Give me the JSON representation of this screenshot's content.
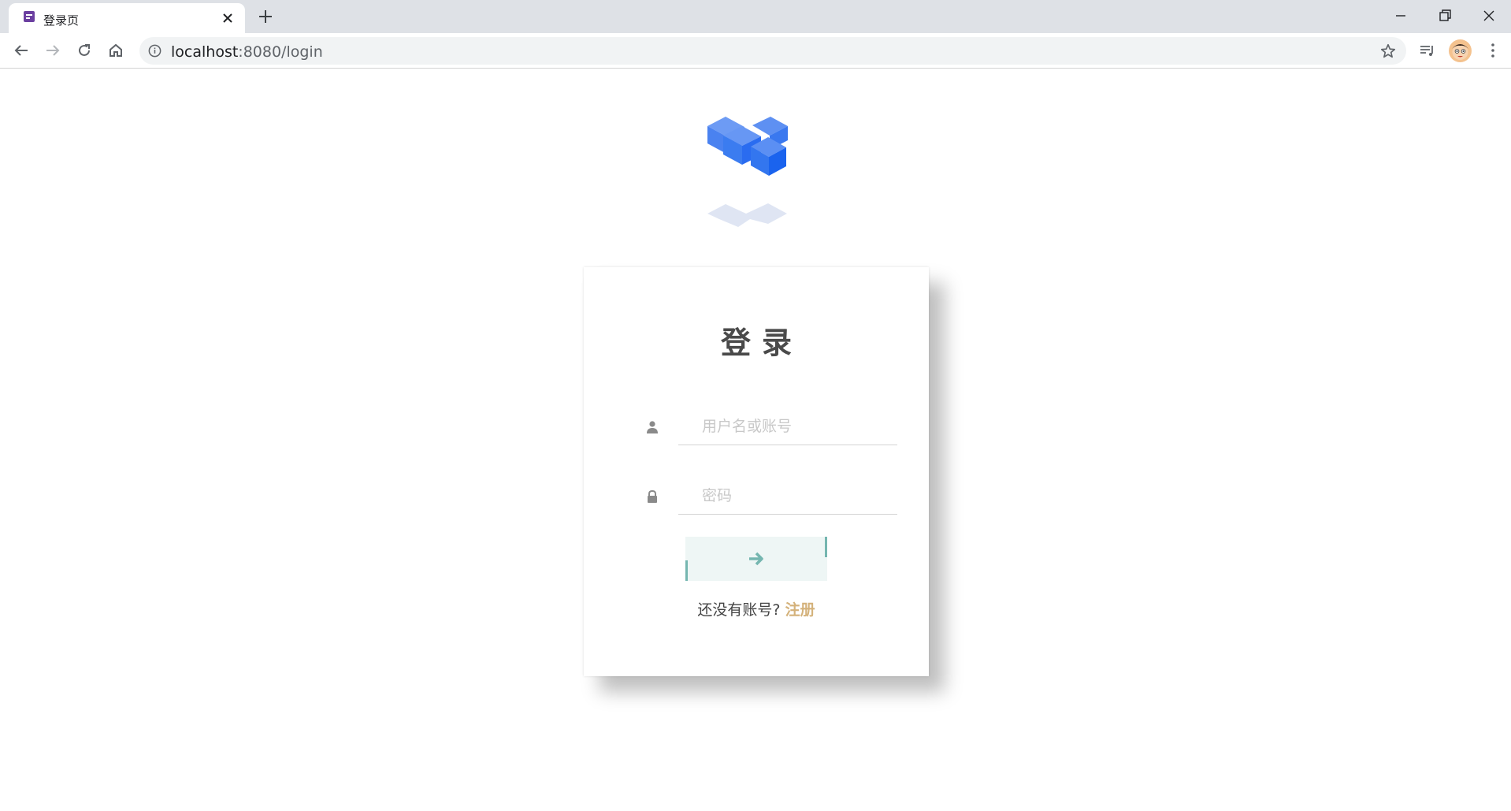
{
  "browser": {
    "tab_title": "登录页",
    "url_host": "localhost",
    "url_rest": ":8080/login"
  },
  "colors": {
    "accent_teal": "#75b6b0",
    "link_gold": "#d4b27b",
    "logo_blue": "#1a6bf0"
  },
  "login": {
    "title": "登录",
    "username_placeholder": "用户名或账号",
    "password_placeholder": "密码",
    "no_account_text": "还没有账号?",
    "register_link": "注册"
  }
}
